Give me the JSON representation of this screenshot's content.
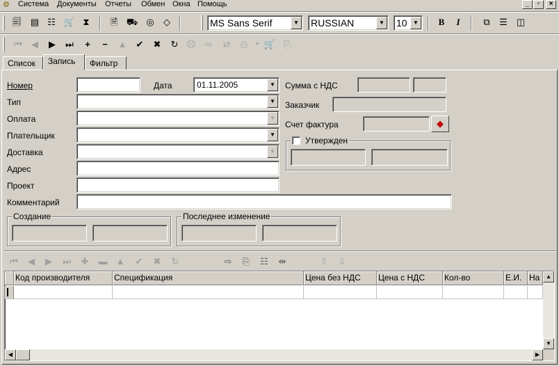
{
  "menubar": {
    "items": [
      "Система",
      "Документы",
      "Отчеты",
      "Обмен",
      "Окна",
      "Помощь"
    ],
    "window_controls": [
      "_",
      "▫",
      "×"
    ]
  },
  "toolbar": {
    "font_name": "MS Sans Serif",
    "charset": "RUSSIAN",
    "font_size": "10",
    "bold": "B",
    "italic": "I"
  },
  "tabs": [
    "Список",
    "Запись",
    "Фильтр"
  ],
  "active_tab": "Запись",
  "form": {
    "nomer_label": "Номер",
    "nomer_value": "",
    "data_label": "Дата",
    "data_value": "01.11.2005",
    "tip_label": "Тип",
    "oplata_label": "Оплата",
    "platelshik_label": "Плательщик",
    "dostavka_label": "Доставка",
    "adres_label": "Адрес",
    "proekt_label": "Проект",
    "kommentariy_label": "Комментарий",
    "summa_label": "Сумма с НДС",
    "zakazchik_label": "Заказчик",
    "schet_label": "Счет фактура",
    "utverzhden_label": "Утвержден",
    "utverzhden_checked": false,
    "sozdanie_label": "Создание",
    "posl_izm_label": "Последнее изменение"
  },
  "grid": {
    "columns": [
      "Код производителя",
      "Спецификация",
      "Цена без НДС",
      "Цена с НДС",
      "Кол-во",
      "Е.И.",
      "На"
    ]
  }
}
